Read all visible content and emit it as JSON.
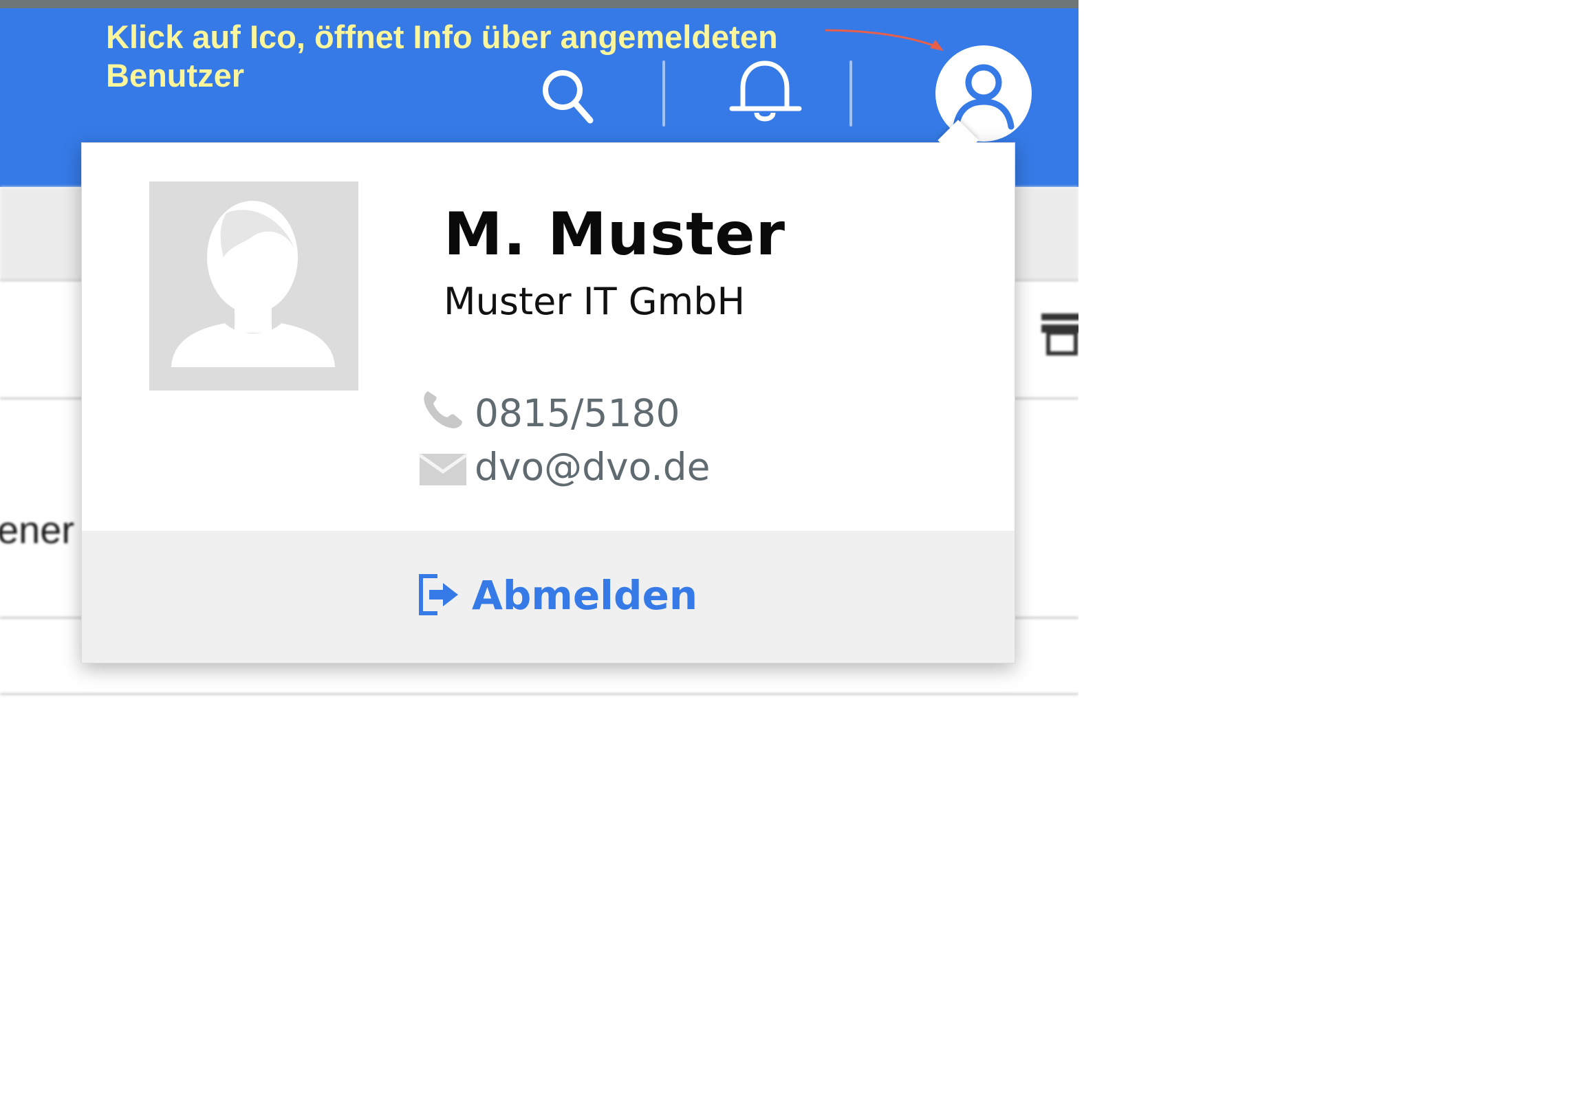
{
  "annotation": {
    "text": "Klick auf Ico, öffnet Info über angemeldeten Benutzer"
  },
  "header": {
    "icons": [
      "search-icon",
      "bell-icon",
      "user-icon"
    ],
    "background_color": "#357ae6"
  },
  "background": {
    "partial_text": "ener"
  },
  "user_popup": {
    "name": "M. Muster",
    "company": "Muster IT GmbH",
    "phone": "0815/5180",
    "email": "dvo@dvo.de",
    "logout_label": "Abmelden"
  },
  "colors": {
    "accent": "#357ae6",
    "annotation": "#fbf59b",
    "arrow": "#e8604c",
    "contact_text": "#5f6b70"
  }
}
